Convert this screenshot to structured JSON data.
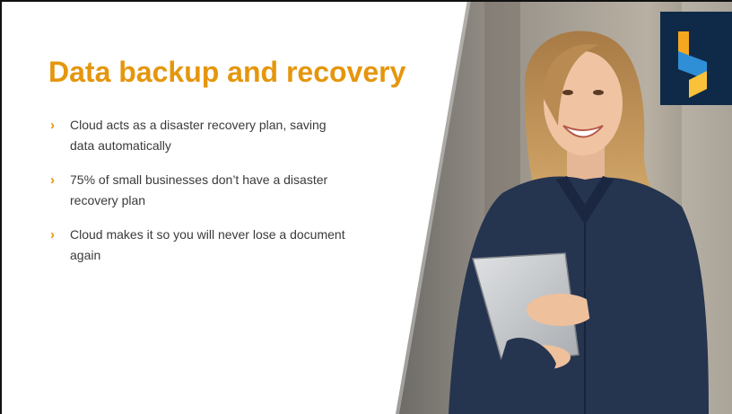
{
  "slide": {
    "title": "Data backup and recovery",
    "bullets": [
      "Cloud acts as a disaster recovery plan, saving data automatically",
      "75% of small businesses don’t have a disaster recovery plan",
      "Cloud makes it so you will never lose a document again"
    ]
  },
  "colors": {
    "accent": "#e5960c",
    "text": "#3a3a3a",
    "logo_bg": "#0f2a48"
  },
  "icons": {
    "bullet": "chevron-right-icon",
    "logo": "brand-logo-icon"
  }
}
